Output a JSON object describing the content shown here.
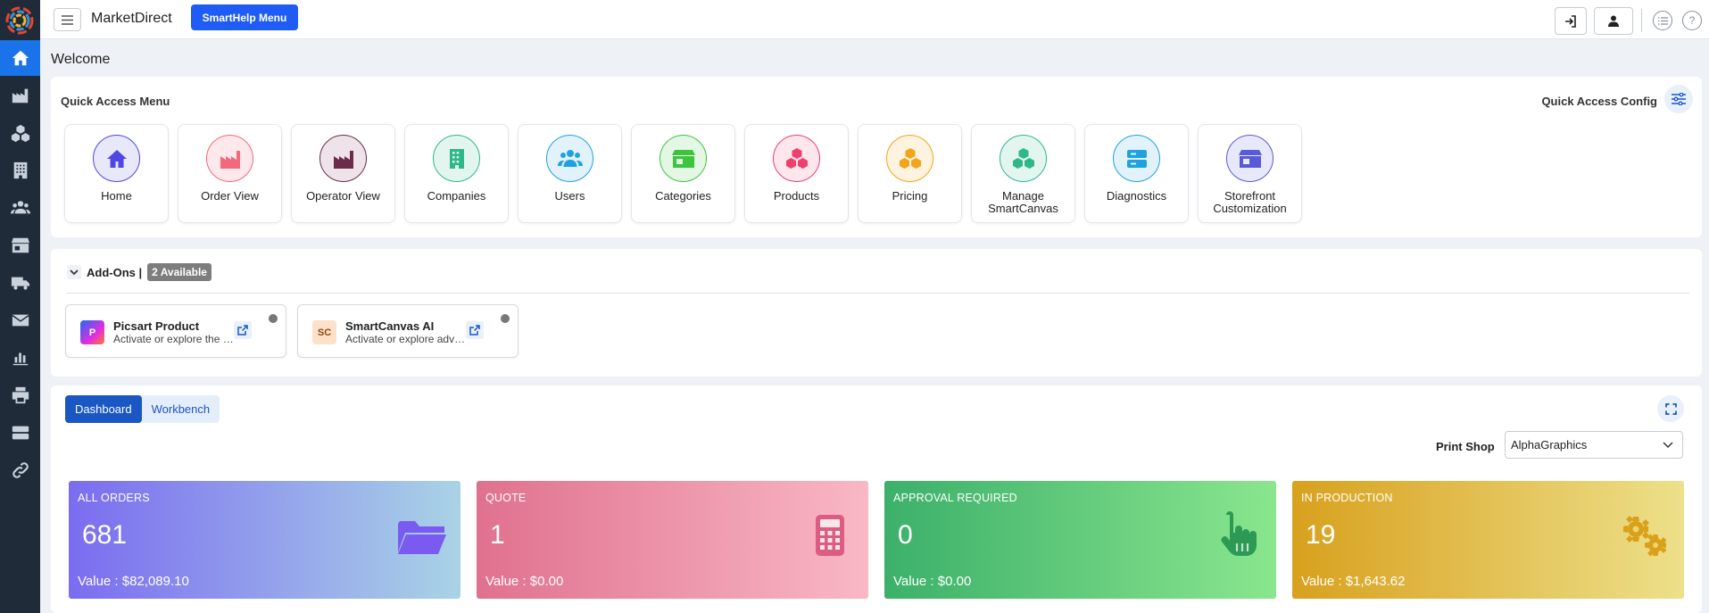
{
  "app": {
    "brand": "MarketDirect",
    "smarthelp_label": "SmartHelp Menu"
  },
  "page": {
    "welcome": "Welcome"
  },
  "quick_access": {
    "title": "Quick Access Menu",
    "config_label": "Quick Access Config",
    "tiles": [
      {
        "label": "Home",
        "icon": "home-icon",
        "color": "#4f46e5",
        "bg": "#e8e8fb"
      },
      {
        "label": "Order View",
        "icon": "factory-icon",
        "color": "#f06a7c",
        "bg": "#fde8ec"
      },
      {
        "label": "Operator View",
        "icon": "factory-icon",
        "color": "#6b2c4a",
        "bg": "#eee3e8"
      },
      {
        "label": "Companies",
        "icon": "building-icon",
        "color": "#2eb88a",
        "bg": "#e2f6ef"
      },
      {
        "label": "Users",
        "icon": "users-icon",
        "color": "#1fa2e0",
        "bg": "#e1f2fb"
      },
      {
        "label": "Categories",
        "icon": "store-icon",
        "color": "#3cc43c",
        "bg": "#e4f7e4"
      },
      {
        "label": "Products",
        "icon": "cubes-icon",
        "color": "#ef3f6e",
        "bg": "#fde6ec"
      },
      {
        "label": "Pricing",
        "icon": "cubes-icon",
        "color": "#f2a51a",
        "bg": "#fdf3de"
      },
      {
        "label": "Manage SmartCanvas",
        "icon": "cubes-icon",
        "color": "#2eb88a",
        "bg": "#e2f6ef"
      },
      {
        "label": "Diagnostics",
        "icon": "server-icon",
        "color": "#1fa2e0",
        "bg": "#e1f2fb"
      },
      {
        "label": "Storefront Customization",
        "icon": "store-icon",
        "color": "#5a5ad6",
        "bg": "#e8e8fb"
      }
    ]
  },
  "addons": {
    "title": "Add-Ons |",
    "badge": "2 Available",
    "items": [
      {
        "name": "Picsart Product",
        "desc": "Activate or explore the Picsart product integration",
        "logo": "P"
      },
      {
        "name": "SmartCanvas AI",
        "desc": "Activate or explore advanced SmartCanvas AI features",
        "logo": "SC"
      }
    ]
  },
  "dashboard": {
    "tabs": [
      "Dashboard",
      "Workbench"
    ],
    "print_shop_label": "Print Shop",
    "print_shop_value": "AlphaGraphics",
    "stats": [
      {
        "title": "ALL ORDERS",
        "count": "681",
        "value": "Value : $82,089.10",
        "icon": "folder-open-icon",
        "from": "#7b6cf0",
        "to": "#a9d3e6",
        "ic": "#7a5af0"
      },
      {
        "title": "QUOTE",
        "count": "1",
        "value": "Value : $0.00",
        "icon": "calculator-icon",
        "from": "#e0718e",
        "to": "#f9b8c6",
        "ic": "#dc5c82"
      },
      {
        "title": "APPROVAL REQUIRED",
        "count": "0",
        "value": "Value : $0.00",
        "icon": "hand-pointer-icon",
        "from": "#3cb06a",
        "to": "#8ae68e",
        "ic": "#2c9a55"
      },
      {
        "title": "IN PRODUCTION",
        "count": "19",
        "value": "Value : $1,643.62",
        "icon": "gears-icon",
        "from": "#d8a11e",
        "to": "#ede08a",
        "ic": "#d9a01a"
      }
    ]
  }
}
